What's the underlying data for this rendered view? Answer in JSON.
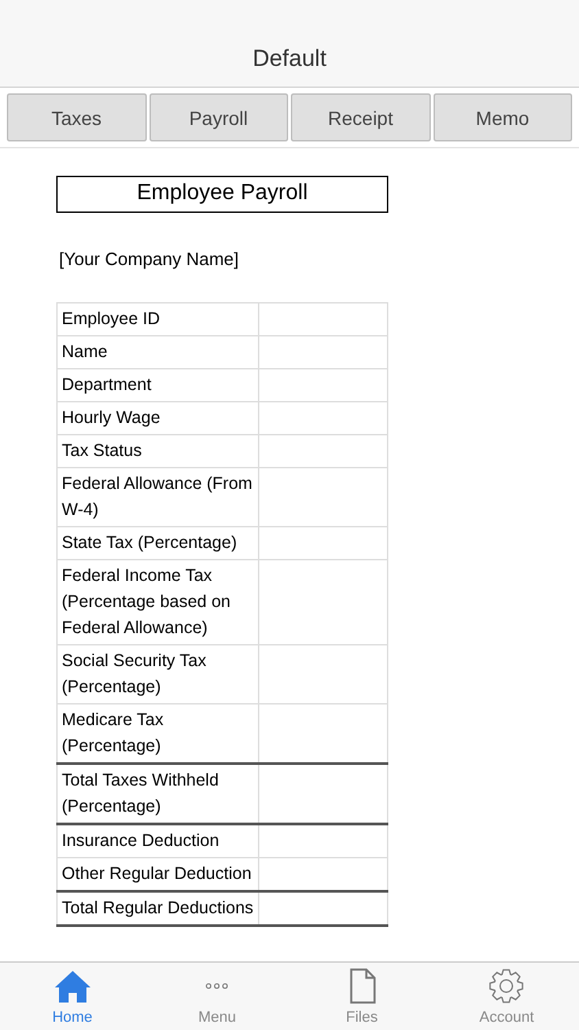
{
  "header": {
    "title": "Default"
  },
  "segments": [
    {
      "label": "Taxes"
    },
    {
      "label": "Payroll"
    },
    {
      "label": "Receipt"
    },
    {
      "label": "Memo"
    }
  ],
  "document": {
    "title": "Employee Payroll",
    "company": "[Your Company Name]",
    "rows": [
      {
        "label": "Employee ID",
        "kind": "item"
      },
      {
        "label": "Name",
        "kind": "item"
      },
      {
        "label": "Department",
        "kind": "item"
      },
      {
        "label": "Hourly Wage",
        "kind": "item"
      },
      {
        "label": "Tax Status",
        "kind": "item"
      },
      {
        "label": "Federal Allowance (From W-4)",
        "kind": "item"
      },
      {
        "label": "State Tax (Percentage)",
        "kind": "item"
      },
      {
        "label": "Federal Income Tax (Percentage based on Federal Allowance)",
        "kind": "item"
      },
      {
        "label": "Social Security Tax (Percentage)",
        "kind": "item"
      },
      {
        "label": "Medicare Tax (Percentage)",
        "kind": "item"
      },
      {
        "label": "Total Taxes Withheld (Percentage)",
        "kind": "total"
      },
      {
        "label": "Insurance Deduction",
        "kind": "item"
      },
      {
        "label": "Other Regular Deduction",
        "kind": "item"
      },
      {
        "label": "Total Regular Deductions",
        "kind": "total"
      }
    ]
  },
  "tabbar": [
    {
      "label": "Home",
      "selected": true
    },
    {
      "label": "Menu",
      "selected": false
    },
    {
      "label": "Files",
      "selected": false
    },
    {
      "label": "Account",
      "selected": false
    }
  ]
}
